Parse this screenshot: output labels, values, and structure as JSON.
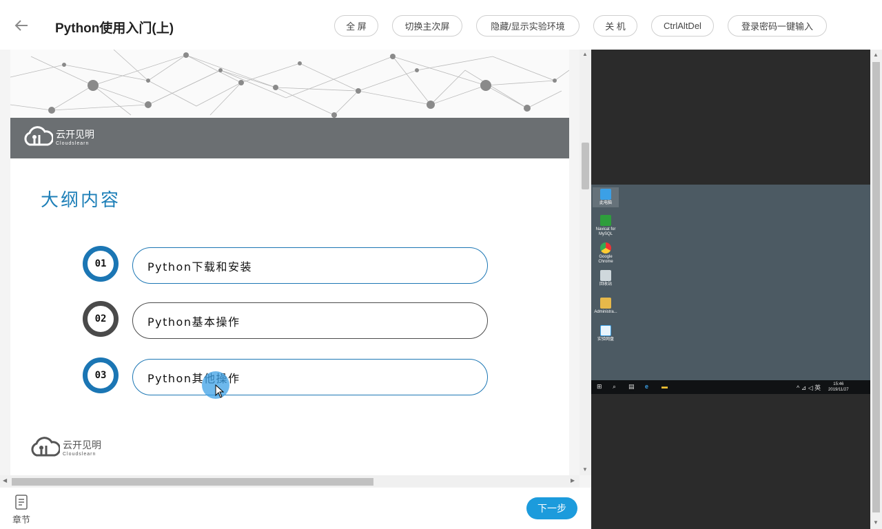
{
  "header": {
    "title": "Python使用入门(上)",
    "buttons": [
      "全 屏",
      "切换主次屏",
      "隐藏/显示实验环境",
      "关 机",
      "CtrlAltDel",
      "登录密码一键输入"
    ]
  },
  "slide": {
    "brand": "云开见明",
    "brand_sub": "Cloudslearn",
    "heading": "大纲内容",
    "items": [
      {
        "num": "01",
        "label": "Python下载和安装",
        "color": "#1b76b4"
      },
      {
        "num": "02",
        "label": "Python基本操作",
        "color": "#4a4a4a"
      },
      {
        "num": "03",
        "label": "Python其他操作",
        "color": "#1b76b4"
      }
    ]
  },
  "bottom": {
    "chapter_label": "章节",
    "next_label": "下一步"
  },
  "vm": {
    "desktop_icons": [
      "此电脑",
      "Navicat for MySQL",
      "Google Chrome",
      "回收站",
      "Administra...",
      "实验网盘"
    ],
    "clock_time": "15:46",
    "clock_date": "2019/11/27"
  },
  "colors": {
    "accent": "#1c9bdc",
    "slide_blue": "#1b76b4",
    "band_gray": "#6b6f72"
  }
}
